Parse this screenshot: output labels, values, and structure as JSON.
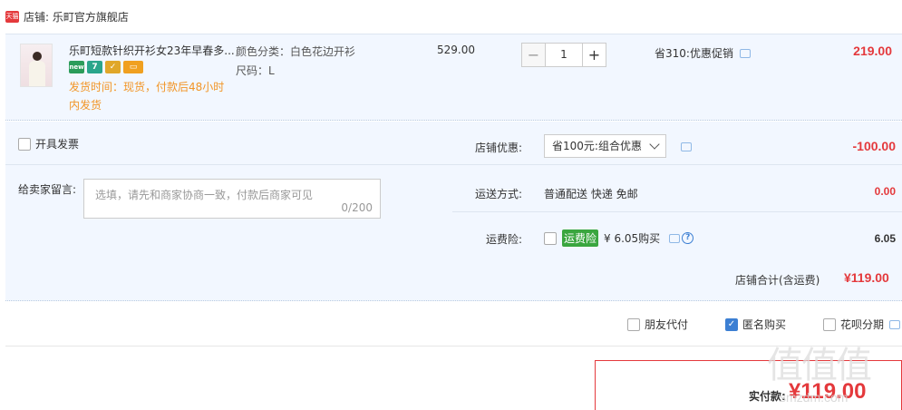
{
  "shop": {
    "badge_text": "天猫",
    "label": "店铺: 乐町官方旗舰店"
  },
  "item": {
    "thumb_text": "",
    "title": "乐町短款针织开衫女23年早春多...",
    "badges": [
      "new",
      "7",
      "",
      ""
    ],
    "ship_time": "发货时间：现货，付款后48小时内发货",
    "attr_color": "颜色分类：白色花边开衫",
    "attr_size": "尺码：L",
    "unit_price": "529.00",
    "qty_minus": "−",
    "qty_value": "1",
    "qty_plus": "+",
    "promo": "省310:优惠促销",
    "total": "219.00"
  },
  "invoice": {
    "label": "开具发票"
  },
  "message": {
    "label": "给卖家留言:",
    "placeholder": "选填，请先和商家协商一致，付款后商家可见",
    "count": "0/200"
  },
  "shop_discount": {
    "label": "店铺优惠:",
    "selected": "省100元:组合优惠",
    "amount": "-100.00"
  },
  "shipping": {
    "label": "运送方式:",
    "value": "普通配送 快递 免邮",
    "amount": "0.00"
  },
  "insurance": {
    "label": "运费险:",
    "tag": "运费险",
    "price_text": "¥ 6.05购买",
    "help": "?",
    "amount": "6.05"
  },
  "store_total": {
    "label": "店铺合计(含运费)",
    "value": "¥119.00"
  },
  "options": {
    "friend_pay": "朋友代付",
    "anonymous": "匿名购买",
    "anonymous_checked": true,
    "huabei": "花呗分期"
  },
  "pay": {
    "label": "实付款:",
    "value": "¥119.00"
  },
  "watermark": {
    "main": "值值值",
    "sub": "smzdm.com"
  },
  "colors": {
    "accent_red": "#e4393c",
    "panel_bg": "#f2f7ff",
    "ship_orange": "#f29526",
    "checkbox_blue": "#3c7fd3",
    "insurance_green": "#3aa63f"
  }
}
